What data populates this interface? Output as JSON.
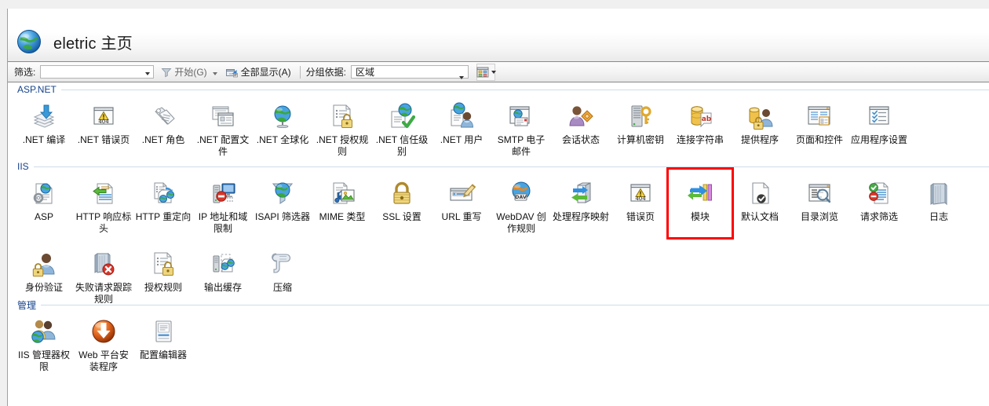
{
  "window": {
    "title": "eletric 主页",
    "globe_icon": "globe-icon"
  },
  "toolbar": {
    "filter_label": "筛选:",
    "filter_value": "",
    "filter_placeholder": "",
    "start_label": "开始(G)",
    "show_all_label": "全部显示(A)",
    "group_by_label": "分组依据:",
    "group_by_value": "区域",
    "view_icon": "view-mode-icon",
    "funnel_icon": "funnel-icon",
    "show_all_icon": "show-all-icon",
    "dropdown_icon": "chevron-down-icon"
  },
  "highlight": {
    "color": "#ff0000",
    "target": "模块"
  },
  "groups": [
    {
      "title": "ASP.NET",
      "rows": [
        [
          {
            "label": ".NET 编译",
            "icon": "net-compilation-icon"
          },
          {
            "label": ".NET 错误页",
            "icon": "net-error-pages-icon"
          },
          {
            "label": ".NET 角色",
            "icon": "net-roles-icon"
          },
          {
            "label": ".NET 配置文件",
            "icon": "net-profile-icon"
          },
          {
            "label": ".NET 全球化",
            "icon": "net-globalization-icon"
          },
          {
            "label": ".NET 授权规则",
            "icon": "net-authorization-rules-icon"
          },
          {
            "label": ".NET 信任级别",
            "icon": "net-trust-levels-icon"
          },
          {
            "label": ".NET 用户",
            "icon": "net-users-icon"
          },
          {
            "label": "SMTP 电子邮件",
            "icon": "smtp-email-icon"
          },
          {
            "label": "会话状态",
            "icon": "session-state-icon"
          },
          {
            "label": "计算机密钥",
            "icon": "machine-key-icon"
          },
          {
            "label": "连接字符串",
            "icon": "connection-strings-icon"
          },
          {
            "label": "提供程序",
            "icon": "providers-icon"
          },
          {
            "label": "页面和控件",
            "icon": "pages-and-controls-icon"
          },
          {
            "label": "应用程序设置",
            "icon": "application-settings-icon"
          }
        ]
      ]
    },
    {
      "title": "IIS",
      "rows": [
        [
          {
            "label": "ASP",
            "icon": "asp-icon"
          },
          {
            "label": "HTTP 响应标头",
            "icon": "http-response-headers-icon"
          },
          {
            "label": "HTTP 重定向",
            "icon": "http-redirect-icon"
          },
          {
            "label": "IP 地址和域限制",
            "icon": "ip-address-domain-restrictions-icon"
          },
          {
            "label": "ISAPI 筛选器",
            "icon": "isapi-filters-icon"
          },
          {
            "label": "MIME 类型",
            "icon": "mime-types-icon"
          },
          {
            "label": "SSL 设置",
            "icon": "ssl-settings-icon"
          },
          {
            "label": "URL 重写",
            "icon": "url-rewrite-icon"
          },
          {
            "label": "WebDAV 创作规则",
            "icon": "webdav-authoring-rules-icon"
          },
          {
            "label": "处理程序映射",
            "icon": "handler-mappings-icon"
          },
          {
            "label": "错误页",
            "icon": "error-pages-icon"
          },
          {
            "label": "模块",
            "icon": "modules-icon"
          },
          {
            "label": "默认文档",
            "icon": "default-document-icon"
          },
          {
            "label": "目录浏览",
            "icon": "directory-browsing-icon"
          },
          {
            "label": "请求筛选",
            "icon": "request-filtering-icon"
          },
          {
            "label": "日志",
            "icon": "logging-icon"
          }
        ],
        [
          {
            "label": "身份验证",
            "icon": "authentication-icon"
          },
          {
            "label": "失败请求跟踪规则",
            "icon": "failed-request-tracing-rules-icon"
          },
          {
            "label": "授权规则",
            "icon": "authorization-rules-icon"
          },
          {
            "label": "输出缓存",
            "icon": "output-caching-icon"
          },
          {
            "label": "压缩",
            "icon": "compression-icon"
          }
        ]
      ]
    },
    {
      "title": "管理",
      "rows": [
        [
          {
            "label": "IIS 管理器权限",
            "icon": "iis-manager-permissions-icon"
          },
          {
            "label": "Web 平台安装程序",
            "icon": "web-platform-installer-icon"
          },
          {
            "label": "配置编辑器",
            "icon": "configuration-editor-icon"
          }
        ]
      ]
    }
  ]
}
